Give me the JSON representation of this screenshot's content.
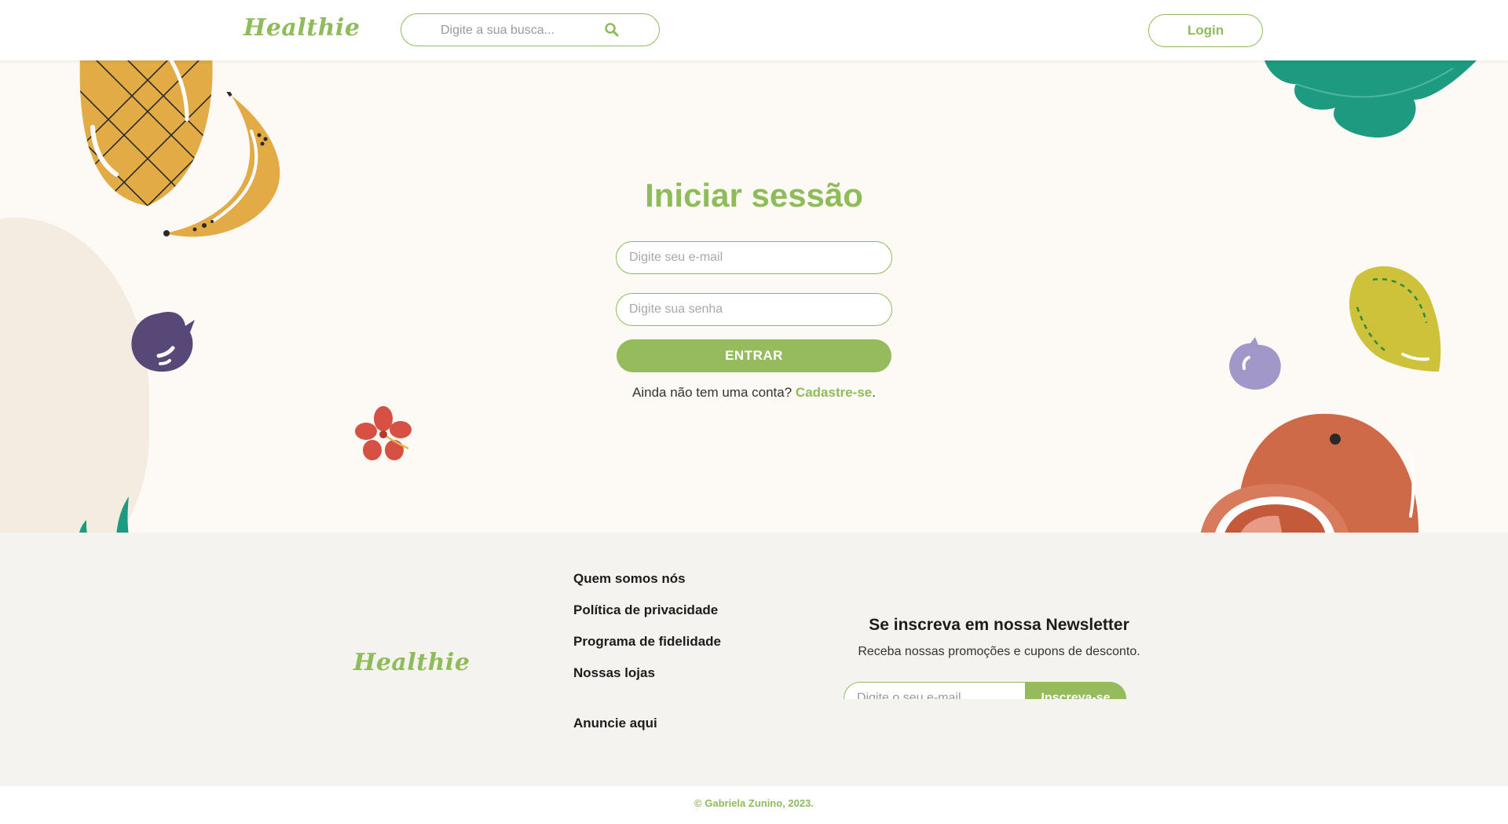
{
  "header": {
    "logo": "Healthie",
    "search_placeholder": "Digite a sua busca...",
    "login_label": "Login"
  },
  "login": {
    "title": "Iniciar sessão",
    "email_placeholder": "Digite seu e-mail",
    "password_placeholder": "Digite sua senha",
    "submit_label": "ENTRAR",
    "no_account_text": "Ainda não tem uma conta?",
    "signup_link": "Cadastre-se",
    "signup_suffix": "."
  },
  "footer": {
    "logo": "Healthie",
    "links": [
      "Quem somos nós",
      "Política de privacidade",
      "Programa de fidelidade",
      "Nossas lojas",
      "Anuncie aqui"
    ],
    "newsletter": {
      "title": "Se inscreva em nossa Newsletter",
      "subtitle": "Receba nossas promoções e cupons de desconto.",
      "email_placeholder": "Digite o seu e-mail",
      "button_label": "Inscreva-se"
    },
    "copyright": "© Gabriela Zunino, 2023."
  },
  "colors": {
    "brand_green": "#8fbc5a",
    "hero_background": "#fdf9f4",
    "footer_background": "#f5f3ef"
  }
}
